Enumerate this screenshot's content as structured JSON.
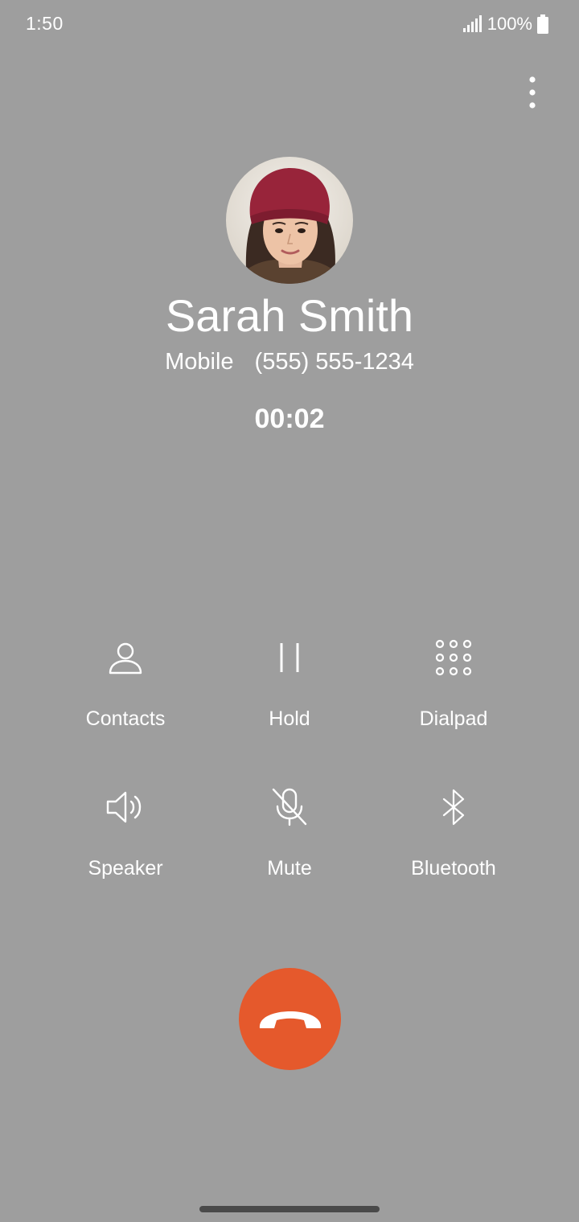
{
  "status_bar": {
    "time": "1:50",
    "battery": "100%",
    "signal_icon": "signal-icon",
    "battery_icon": "battery-full-icon"
  },
  "menu": {
    "icon": "more-vert-icon"
  },
  "caller": {
    "name": "Sarah Smith",
    "number_type": "Mobile",
    "number": "(555) 555-1234",
    "avatar_icon": "contact-photo"
  },
  "call": {
    "timer": "00:02"
  },
  "controls": [
    {
      "label": "Contacts",
      "icon": "person-icon"
    },
    {
      "label": "Hold",
      "icon": "pause-icon"
    },
    {
      "label": "Dialpad",
      "icon": "dialpad-icon"
    },
    {
      "label": "Speaker",
      "icon": "speaker-icon"
    },
    {
      "label": "Mute",
      "icon": "mic-off-icon"
    },
    {
      "label": "Bluetooth",
      "icon": "bluetooth-icon"
    }
  ],
  "end_call": {
    "icon": "end-call-icon"
  },
  "colors": {
    "background": "#9e9e9e",
    "end_call": "#e5592c",
    "text": "#ffffff"
  }
}
